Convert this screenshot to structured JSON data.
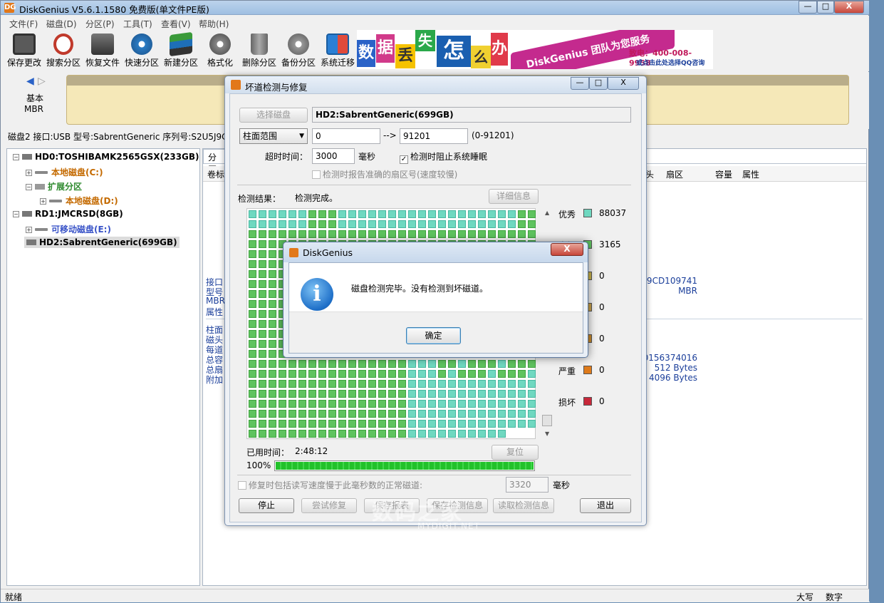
{
  "app": {
    "title": "DiskGenius V5.6.1.1580 免费版(单文件PE版)",
    "icon": "DG"
  },
  "window_controls": {
    "minimize": "—",
    "maximize": "□",
    "close": "X"
  },
  "menu": [
    "文件(F)",
    "磁盘(D)",
    "分区(P)",
    "工具(T)",
    "查看(V)",
    "帮助(H)"
  ],
  "toolbar": [
    {
      "label": "保存更改",
      "icon": "save-icon"
    },
    {
      "label": "搜索分区",
      "icon": "search-icon"
    },
    {
      "label": "恢复文件",
      "icon": "recover-icon"
    },
    {
      "label": "快速分区",
      "icon": "quick-partition-icon"
    },
    {
      "label": "新建分区",
      "icon": "new-partition-icon"
    },
    {
      "label": "格式化",
      "icon": "format-icon"
    },
    {
      "label": "删除分区",
      "icon": "delete-icon"
    },
    {
      "label": "备份分区",
      "icon": "backup-icon"
    },
    {
      "label": "系统迁移",
      "icon": "migrate-icon"
    }
  ],
  "banner": {
    "chars": [
      "数",
      "据",
      "丢",
      "失",
      "怎",
      "么",
      "办"
    ],
    "slogan": "DiskGenius 团队为您服务",
    "phone": "致电：400-008-9958",
    "qq": "或点击此处选择QQ咨询"
  },
  "disk_nav": {
    "type": "基本",
    "scheme": "MBR"
  },
  "disk_info_line": "磁盘2 接口:USB  型号:SabrentGeneric  序列号:S2U5J9C",
  "tree": [
    {
      "label": "HD0:TOSHIBAMK2565GSX(233GB)",
      "kind": "disk"
    },
    {
      "label": "本地磁盘(C:)",
      "kind": "partition",
      "color": "#c46a00"
    },
    {
      "label": "扩展分区",
      "kind": "extended",
      "color": "#2e8a2e"
    },
    {
      "label": "本地磁盘(D:)",
      "kind": "partition",
      "color": "#c46a00"
    },
    {
      "label": "RD1:JMCRSD(8GB)",
      "kind": "disk"
    },
    {
      "label": "可移动磁盘(E:)",
      "kind": "partition",
      "color": "#3a54c8"
    },
    {
      "label": "HD2:SabrentGeneric(699GB)",
      "kind": "disk-selected"
    }
  ],
  "right_panel": {
    "tab": "分区",
    "col_volume": "卷标",
    "columns": [
      "头",
      "扇区",
      "容量",
      "属性"
    ],
    "left_labels_a": [
      "接口",
      "型号",
      "MBR",
      "属性"
    ],
    "left_labels_b": [
      "柱面",
      "磁头",
      "每道",
      "总容",
      "总扇",
      "附加"
    ],
    "values_a": [
      "J9CD109741",
      "MBR"
    ],
    "values_b": [
      "0156374016",
      "512 Bytes",
      "4096 Bytes"
    ]
  },
  "status_bar": {
    "left": "就绪",
    "caps": "大写",
    "num": "数字"
  },
  "bad_track_dialog": {
    "title": "坏道检测与修复",
    "select_disk_button": "选择磁盘",
    "disk_name": "HD2:SabrentGeneric(699GB)",
    "range_mode": "柱面范围",
    "range_start": "0",
    "range_arrow": "-->",
    "range_end": "91201",
    "range_hint": "(0-91201)",
    "timeout_label": "超时时间：",
    "timeout_value": "3000",
    "timeout_unit": "毫秒",
    "prevent_sleep": "检测时阻止系统睡眠",
    "prevent_sleep_checked": true,
    "report_sector": "检测时报告准确的扇区号(速度较慢)",
    "report_sector_checked": false,
    "result_label": "检测结果：",
    "result_value": "检测完成。",
    "detail_button": "详细信息",
    "legend": [
      {
        "name": "优秀",
        "color": "#6fd8c0",
        "count": "88037"
      },
      {
        "name": "良好",
        "color": "#5fc35f",
        "count": "3165"
      },
      {
        "name": "",
        "color": "#c9b24a",
        "count": "0"
      },
      {
        "name": "",
        "color": "#c9a14a",
        "count": "0"
      },
      {
        "name": "",
        "color": "#c98a2a",
        "count": "0"
      },
      {
        "name": "严重",
        "color": "#de7a1a",
        "count": "0"
      },
      {
        "name": "损坏",
        "color": "#c8283a",
        "count": "0"
      }
    ],
    "elapsed_label": "已用时间：",
    "elapsed_value": "2:48:12",
    "reset_button": "复位",
    "progress_text": "100%",
    "progress": 1.0,
    "repair_option": "修复时包括读写速度慢于此毫秒数的正常磁道:",
    "repair_ms": "3320",
    "repair_unit": "毫秒",
    "buttons": {
      "stop": "停止",
      "try_repair": "尝试修复",
      "save_report": "保存报表",
      "save_info": "保存检测信息",
      "load_info": "读取检测信息",
      "exit": "退出"
    }
  },
  "message_box": {
    "title": "DiskGenius",
    "message": "磁盘检测完毕。没有检测到坏磁道。",
    "ok": "确定",
    "close": "X"
  },
  "watermark": {
    "main": "数码之家",
    "sub": "MYDIGIT.NET"
  }
}
